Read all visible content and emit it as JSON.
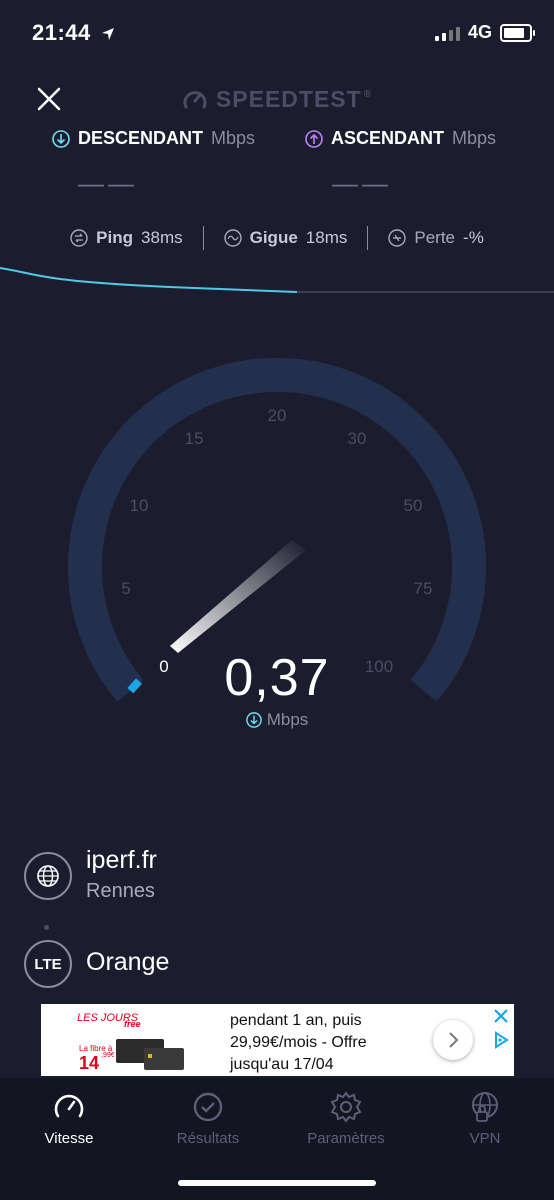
{
  "status_bar": {
    "time": "21:44",
    "network": "4G"
  },
  "header": {
    "brand": "SPEEDTEST",
    "brand_tm": "®"
  },
  "rates": {
    "download": {
      "label": "DESCENDANT",
      "unit": "Mbps",
      "value": "——",
      "color": "#6ee0f0"
    },
    "upload": {
      "label": "ASCENDANT",
      "unit": "Mbps",
      "value": "——",
      "color": "#c07fff"
    }
  },
  "metrics": {
    "ping": {
      "label": "Ping",
      "value": "38",
      "unit": "ms"
    },
    "jitter": {
      "label": "Gigue",
      "value": "18",
      "unit": "ms"
    },
    "loss": {
      "label": "Perte",
      "value": "-",
      "unit": "%"
    }
  },
  "gauge": {
    "ticks": [
      "0",
      "5",
      "10",
      "15",
      "20",
      "30",
      "50",
      "75",
      "100"
    ],
    "value": "0,37",
    "unit": "Mbps",
    "accent": "#1aa6e6",
    "track": "#23304d"
  },
  "server": {
    "host": "iperf.fr",
    "city": "Rennes"
  },
  "isp": {
    "badge": "LTE",
    "name": "Orange"
  },
  "ad": {
    "brand_a": "LES JOURS",
    "brand_b": "free",
    "tag": "La fibre à",
    "price": "14",
    "price_cents": ",99€ /mois",
    "text": "pendant 1 an, puis 29,99€/mois - Offre jusqu'au 17/04"
  },
  "nav": [
    {
      "label": "Vitesse",
      "active": true
    },
    {
      "label": "Résultats",
      "active": false
    },
    {
      "label": "Paramètres",
      "active": false
    },
    {
      "label": "VPN",
      "active": false
    }
  ]
}
